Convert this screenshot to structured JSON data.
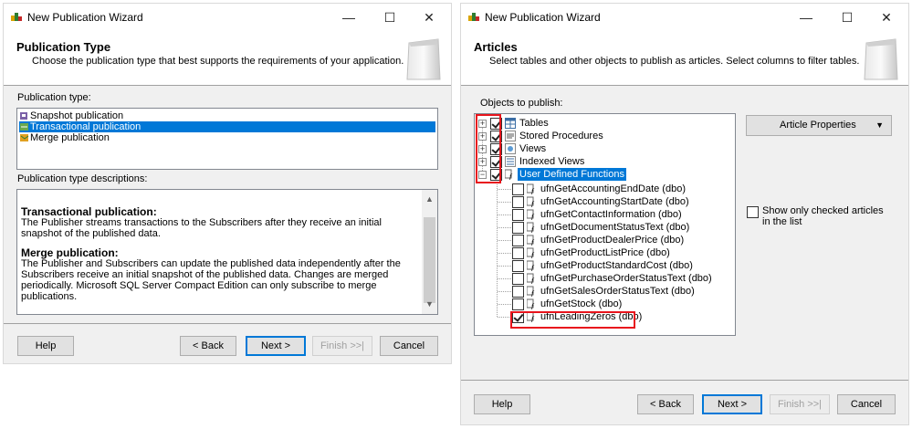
{
  "left_window": {
    "title": "New Publication Wizard",
    "caption_minimize": "—",
    "caption_maximize": "☐",
    "caption_close": "✕",
    "header_title": "Publication Type",
    "header_subtitle": "Choose the publication type that best supports the requirements of your application.",
    "publication_type_label": "Publication type:",
    "publication_types": [
      {
        "label": "Snapshot publication",
        "selected": false
      },
      {
        "label": "Transactional publication",
        "selected": true
      },
      {
        "label": "Merge publication",
        "selected": false
      }
    ],
    "descriptions_label": "Publication type descriptions:",
    "desc_transactional_heading": "Transactional publication:",
    "desc_transactional_body": "The Publisher streams transactions to the Subscribers after they receive an initial snapshot of the published data.",
    "desc_merge_heading": "Merge publication:",
    "desc_merge_body": "The Publisher and Subscribers can update the published data independently after the Subscribers receive an initial snapshot of the published data. Changes are merged periodically. Microsoft SQL Server Compact Edition can only subscribe to merge publications.",
    "buttons": {
      "help": "Help",
      "back": "< Back",
      "next": "Next >",
      "finish": "Finish >>|",
      "cancel": "Cancel"
    }
  },
  "right_window": {
    "title": "New Publication Wizard",
    "caption_minimize": "—",
    "caption_maximize": "☐",
    "caption_close": "✕",
    "header_title": "Articles",
    "header_subtitle": "Select tables and other objects to publish as articles. Select columns to filter tables.",
    "objects_label": "Objects to publish:",
    "tree_top": [
      {
        "label": "Tables",
        "checked": true,
        "expander": "+"
      },
      {
        "label": "Stored Procedures",
        "checked": true,
        "expander": "+"
      },
      {
        "label": "Views",
        "checked": true,
        "expander": "+"
      },
      {
        "label": "Indexed Views",
        "checked": true,
        "expander": "+"
      },
      {
        "label": "User Defined Functions",
        "checked": true,
        "expander": "−",
        "selected": true
      }
    ],
    "functions": [
      {
        "label": "ufnGetAccountingEndDate (dbo)",
        "checked": false
      },
      {
        "label": "ufnGetAccountingStartDate (dbo)",
        "checked": false
      },
      {
        "label": "ufnGetContactInformation (dbo)",
        "checked": false
      },
      {
        "label": "ufnGetDocumentStatusText (dbo)",
        "checked": false
      },
      {
        "label": "ufnGetProductDealerPrice (dbo)",
        "checked": false
      },
      {
        "label": "ufnGetProductListPrice (dbo)",
        "checked": false
      },
      {
        "label": "ufnGetProductStandardCost (dbo)",
        "checked": false
      },
      {
        "label": "ufnGetPurchaseOrderStatusText (dbo)",
        "checked": false
      },
      {
        "label": "ufnGetSalesOrderStatusText (dbo)",
        "checked": false
      },
      {
        "label": "ufnGetStock (dbo)",
        "checked": false
      },
      {
        "label": "ufnLeadingZeros (dbo)",
        "checked": true
      }
    ],
    "article_properties": "Article Properties",
    "show_only_checked": "Show only checked articles in the list",
    "buttons": {
      "help": "Help",
      "back": "< Back",
      "next": "Next >",
      "finish": "Finish >>|",
      "cancel": "Cancel"
    }
  },
  "colors": {
    "selection": "#0078d7",
    "highlight_box": "#e8141c"
  }
}
